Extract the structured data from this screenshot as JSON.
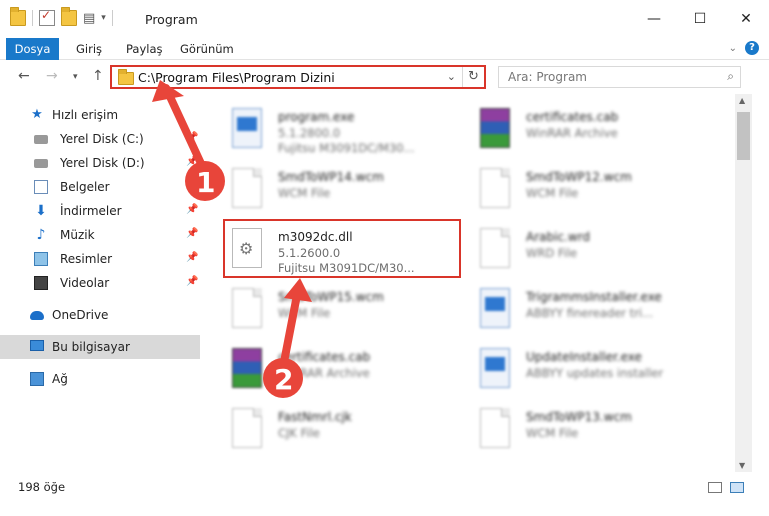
{
  "window": {
    "title": "Program"
  },
  "ribbon": {
    "tabs": [
      "Dosya",
      "Giriş",
      "Paylaş",
      "Görünüm"
    ]
  },
  "address": {
    "path": "C:\\Program Files\\Program Dizini"
  },
  "search": {
    "placeholder": "Ara: Program"
  },
  "sidebar": {
    "items": [
      {
        "label": "Hızlı erişim"
      },
      {
        "label": "Yerel Disk (C:)"
      },
      {
        "label": "Yerel Disk (D:)"
      },
      {
        "label": "Belgeler"
      },
      {
        "label": "İndirmeler"
      },
      {
        "label": "Müzik"
      },
      {
        "label": "Resimler"
      },
      {
        "label": "Videolar"
      },
      {
        "label": "OneDrive"
      },
      {
        "label": "Bu bilgisayar"
      },
      {
        "label": "Ağ"
      }
    ]
  },
  "files": [
    {
      "name": "program.exe",
      "meta1": "5.1.2800.0",
      "meta2": "Fujitsu M3091DC/M30...",
      "icon": "exe-icon"
    },
    {
      "name": "certificates.cab",
      "meta1": "WinRAR Archive",
      "meta2": "",
      "icon": "rar-icon"
    },
    {
      "name": "SmdToWP14.wcm",
      "meta1": "WCM File",
      "meta2": "",
      "icon": "document-icon"
    },
    {
      "name": "SmdToWP12.wcm",
      "meta1": "WCM File",
      "meta2": "",
      "icon": "document-icon"
    },
    {
      "name": "m3092dc.dll",
      "meta1": "5.1.2600.0",
      "meta2": "Fujitsu M3091DC/M30...",
      "icon": "dll-icon"
    },
    {
      "name": "Arabic.wrd",
      "meta1": "WRD File",
      "meta2": "",
      "icon": "document-icon"
    },
    {
      "name": "SmdToWP15.wcm",
      "meta1": "WCM File",
      "meta2": "",
      "icon": "document-icon"
    },
    {
      "name": "TrigrammsInstaller.exe",
      "meta1": "ABBYY finereader tri...",
      "meta2": "",
      "icon": "exe-icon"
    },
    {
      "name": "certificates.cab",
      "meta1": "WinRAR Archive",
      "meta2": "",
      "icon": "rar-icon"
    },
    {
      "name": "UpdateInstaller.exe",
      "meta1": "ABBYY updates installer",
      "meta2": "",
      "icon": "exe-icon"
    },
    {
      "name": "FastNmrl.cjk",
      "meta1": "CJK File",
      "meta2": "",
      "icon": "document-icon"
    },
    {
      "name": "SmdToWP13.wcm",
      "meta1": "WCM File",
      "meta2": "",
      "icon": "document-icon"
    }
  ],
  "status": {
    "count": "198 öğe"
  },
  "callouts": [
    "1",
    "2"
  ],
  "colors": {
    "accent": "#1979ca",
    "highlight": "#d9352a",
    "selection": "#d9d9d9"
  }
}
